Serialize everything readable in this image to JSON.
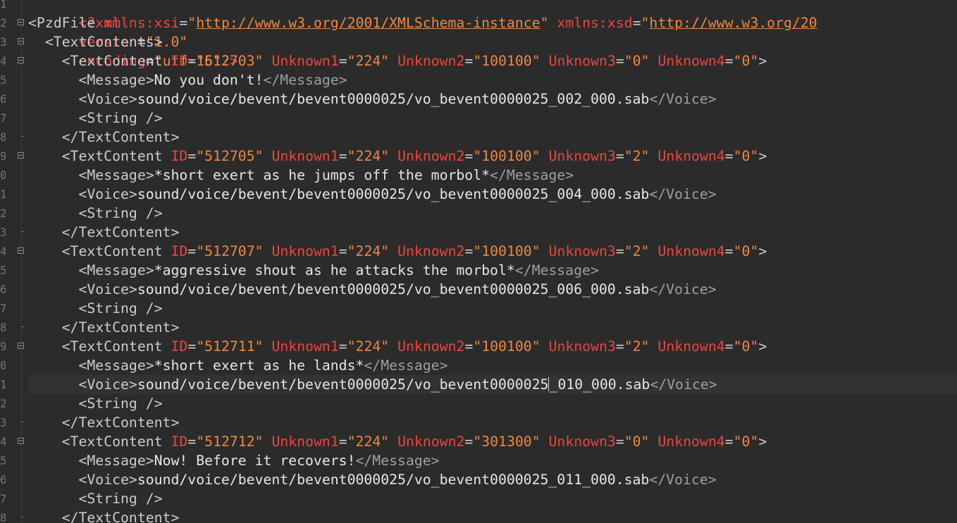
{
  "editor": {
    "gutter_numbers": [
      "1",
      "2",
      "3",
      "4",
      "5",
      "6",
      "7",
      "8",
      "9",
      "0",
      "1",
      "2",
      "3",
      "4",
      "5",
      "6",
      "7",
      "8",
      "9",
      "0",
      "1",
      "2",
      "3",
      "4",
      "5",
      "6",
      "7",
      "8"
    ],
    "current_line_index": 20
  },
  "xml": {
    "declaration": {
      "open": "<?xml",
      "version_attr": "version",
      "version_value": "\"1.0\"",
      "encoding_attr": "encoding",
      "encoding_value": "\"utf-16\"",
      "close": "?>"
    },
    "root": {
      "open": "<PzdFile",
      "xsi_attr": "xmlns:xsi",
      "xsi_value": "http://www.w3.org/2001/XMLSchema-instance",
      "xsd_attr": "xmlns:xsd",
      "xsd_value": "http://www.w3.org/20"
    },
    "text_contents_open": "<TextContents>",
    "entries": [
      {
        "id": "\"512703\"",
        "u1": "\"224\"",
        "u2": "\"100100\"",
        "u3": "\"0\"",
        "u4": "\"0\"",
        "message": "No you don't!",
        "voice": "sound/voice/bevent/bevent0000025/vo_bevent0000025_002_000.sab"
      },
      {
        "id": "\"512705\"",
        "u1": "\"224\"",
        "u2": "\"100100\"",
        "u3": "\"2\"",
        "u4": "\"0\"",
        "message": "*short exert as he jumps off the morbol*",
        "voice": "sound/voice/bevent/bevent0000025/vo_bevent0000025_004_000.sab"
      },
      {
        "id": "\"512707\"",
        "u1": "\"224\"",
        "u2": "\"100100\"",
        "u3": "\"2\"",
        "u4": "\"0\"",
        "message": "*aggressive shout as he attacks the morbol*",
        "voice": "sound/voice/bevent/bevent0000025/vo_bevent0000025_006_000.sab"
      },
      {
        "id": "\"512711\"",
        "u1": "\"224\"",
        "u2": "\"100100\"",
        "u3": "\"2\"",
        "u4": "\"0\"",
        "message": "*short exert as he lands*",
        "voice_a": "sound/voice/bevent/bevent0000025/vo_bevent0000025",
        "voice_b": "_010_000.sab"
      },
      {
        "id": "\"512712\"",
        "u1": "\"224\"",
        "u2": "\"301300\"",
        "u3": "\"0\"",
        "u4": "\"0\"",
        "message": "Now! Before it recovers!",
        "voice": "sound/voice/bevent/bevent0000025/vo_bevent0000025_011_000.sab"
      }
    ],
    "labels": {
      "text_content_open": "<TextContent",
      "text_content_close": "</TextContent>",
      "id_attr": "ID",
      "u1_attr": "Unknown1",
      "u2_attr": "Unknown2",
      "u3_attr": "Unknown3",
      "u4_attr": "Unknown4",
      "gt": ">",
      "eq": "=",
      "message_open": "<Message>",
      "message_close": "</Message>",
      "voice_open": "<Voice>",
      "voice_close": "</Voice>",
      "string_empty": "<String />"
    }
  }
}
